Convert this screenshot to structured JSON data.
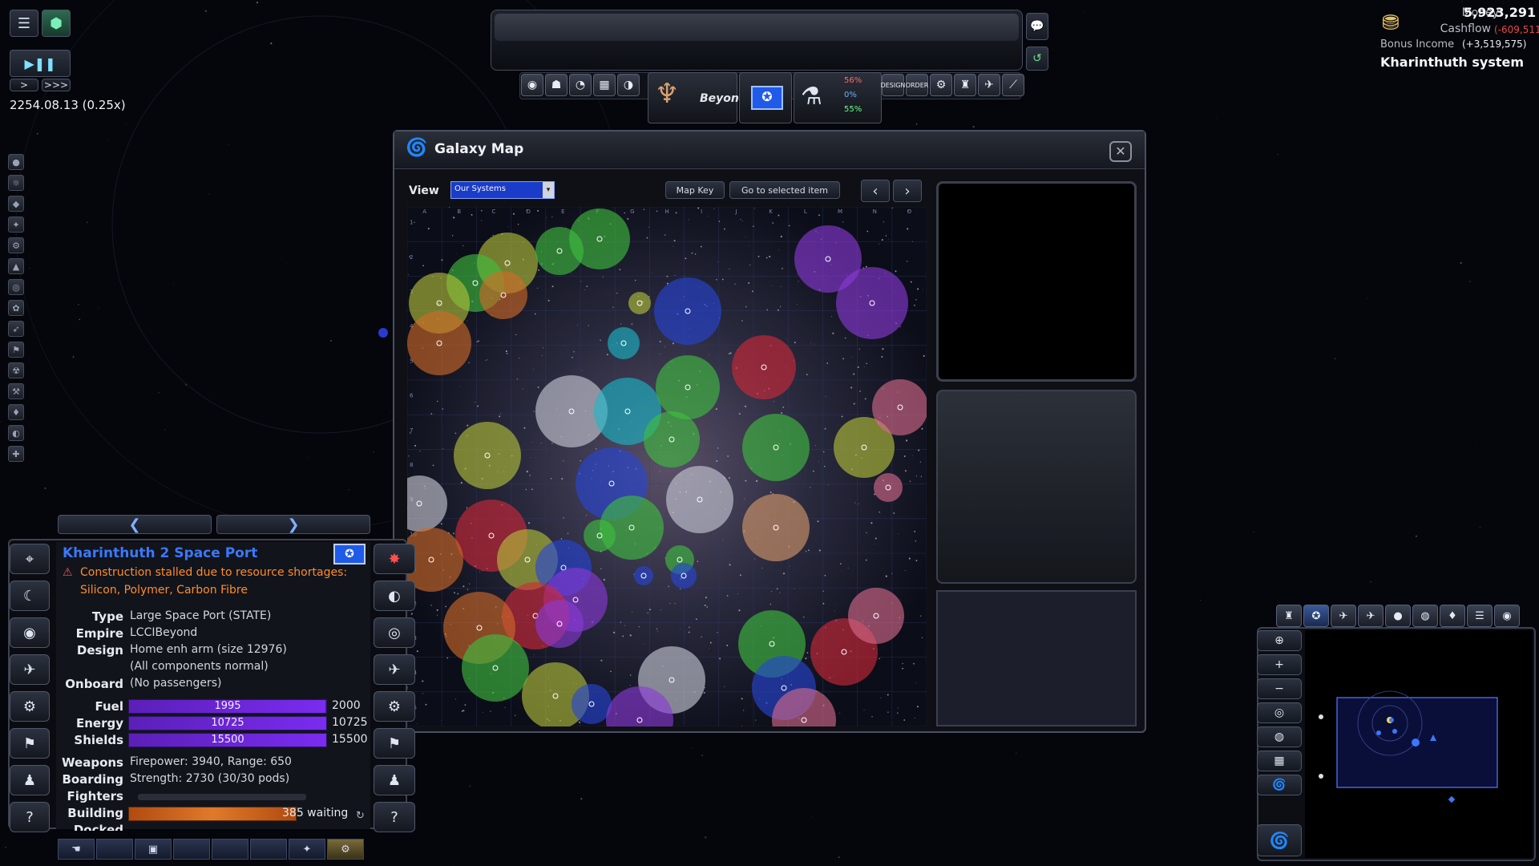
{
  "game": {
    "date_speed": "2254.08.13  (0.25x)",
    "speed_buttons": [
      ">",
      ">>>"
    ]
  },
  "finance": {
    "money_label": "Money",
    "money_value": "5,923,291",
    "cashflow_label": "Cashflow",
    "cashflow_value": "(-609,511)",
    "bonus_label": "Bonus Income",
    "bonus_value": "(+3,519,575)",
    "location": "Kharinthuth system"
  },
  "toolbar": {
    "empire_name": "Beyond",
    "research_percents": [
      "56%",
      "0%",
      "55%"
    ],
    "design_label": "DESIGN",
    "order_label": "ORDER"
  },
  "galaxy_map": {
    "title": "Galaxy Map",
    "view_label": "View",
    "view_selected": "Our Systems",
    "map_key_label": "Map Key",
    "goto_label": "Go to selected item",
    "col_labels": [
      "A",
      "B",
      "C",
      "D",
      "E",
      "F",
      "G",
      "H",
      "I",
      "J",
      "K",
      "L",
      "M",
      "N",
      "O"
    ],
    "row_labels": [
      "1",
      "2",
      "3",
      "4",
      "5",
      "6",
      "7",
      "8",
      "9",
      "10",
      "11",
      "12",
      "13",
      "14",
      "15"
    ],
    "colors": {
      "green": "#3fbf3f",
      "olive": "#b5c23a",
      "orange": "#d06a28",
      "blue": "#2746d6",
      "cyan": "#1ab8c8",
      "purple": "#8a3ad8",
      "red": "#d02838",
      "pink": "#d86a8a",
      "white": "#c9ccd6",
      "magenta": "#d23ad2",
      "tan": "#d69a6a"
    }
  },
  "selected": {
    "title": "Kharinthuth 2 Space Port",
    "alert_line1": "Construction stalled due to resource shortages:",
    "alert_line2": "Silicon, Polymer, Carbon Fibre",
    "type_label": "Type",
    "type_value": "Large Space Port (STATE)",
    "empire_label": "Empire",
    "empire_value": "LCCIBeyond",
    "design_label": "Design",
    "design_value": "Home enh arm (size 12976)",
    "components_value": "(All components normal)",
    "onboard_label": "Onboard",
    "onboard_value": "(No passengers)",
    "fuel_label": "Fuel",
    "fuel_value": "1995",
    "fuel_max": "2000",
    "fuel_fraction": 0.9975,
    "energy_label": "Energy",
    "energy_value": "10725",
    "energy_max": "10725",
    "energy_fraction": 1.0,
    "shields_label": "Shields",
    "shields_value": "15500",
    "shields_max": "15500",
    "shields_fraction": 1.0,
    "weapons_label": "Weapons",
    "weapons_value": "Firepower: 3940, Range: 650",
    "boarding_label": "Boarding",
    "boarding_value": "Strength: 2730  (30/30 pods)",
    "fighters_label": "Fighters",
    "building_label": "Building",
    "building_value": "385 waiting",
    "docked_label": "Docked"
  }
}
